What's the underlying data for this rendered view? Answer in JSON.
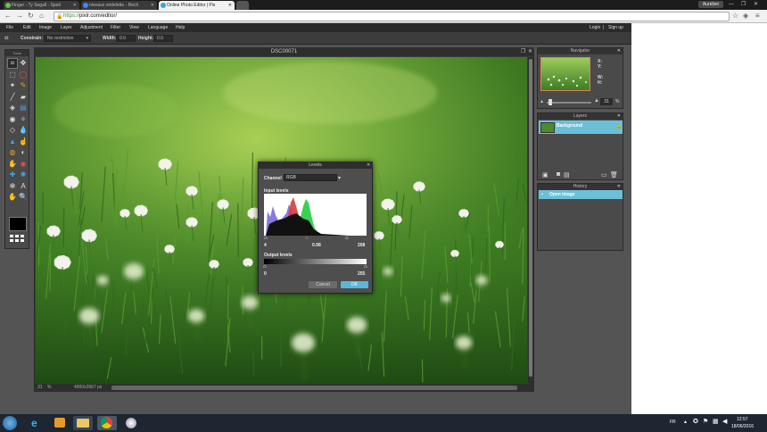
{
  "browser": {
    "tabs": [
      {
        "label": "Finger - Ty Segall - Spoti",
        "active": false,
        "favicon_color": "#6ac24b"
      },
      {
        "label": "niveaux ondelette - Rech",
        "active": false,
        "favicon_color": "#4285f4"
      },
      {
        "label": "Online Photo Editor | Pix",
        "active": true,
        "favicon_color": "#3aa6d0"
      }
    ],
    "profile_label": "Aurelien",
    "url_scheme": "https://",
    "url_rest": "pixlr.com/editor/"
  },
  "menubar": [
    "File",
    "Edit",
    "Image",
    "Layer",
    "Adjustment",
    "Filter",
    "View",
    "Language",
    "Help"
  ],
  "account": {
    "login": "Login",
    "separator": "|",
    "signup": "Sign up"
  },
  "options": {
    "constrain_label": "Constrain:",
    "constrain_value": "No restriction",
    "width_label": "Width:",
    "width_value": "0.0",
    "height_label": "Height:",
    "height_value": "0.0"
  },
  "tools": {
    "title": "Tools",
    "icons": [
      "crop-icon",
      "move-icon",
      "marquee-icon",
      "lasso-icon",
      "wand-icon",
      "pencil-icon",
      "brush-icon",
      "eraser-icon",
      "bucket-icon",
      "gradient-icon",
      "clone-icon",
      "color-replace-icon",
      "drawing-icon",
      "blur-icon",
      "sharpen-icon",
      "smudge-icon",
      "sponge-icon",
      "dodge-icon",
      "burn-icon",
      "red-eye-icon",
      "spot-heal-icon",
      "bloat-icon",
      "pinch-icon",
      "type-icon",
      "hand-icon",
      "zoom-icon"
    ]
  },
  "canvas": {
    "title": "DSC00071",
    "zoom": "31",
    "percent": "%",
    "dimensions": "4000x2667 px"
  },
  "navigator": {
    "title": "Navigator",
    "x_label": "X:",
    "y_label": "Y:",
    "w_label": "W:",
    "h_label": "H:",
    "zoom": "31",
    "percent": "%"
  },
  "layers": {
    "title": "Layers",
    "items": [
      {
        "name": "Background"
      }
    ]
  },
  "history": {
    "title": "History",
    "items": [
      {
        "name": "Open image"
      }
    ]
  },
  "dialog": {
    "title": "Levels",
    "channel_label": "Channel",
    "channel_value": "RGB",
    "input_label": "Input levels",
    "input_low": "4",
    "input_gamma": "0.98",
    "input_high": "208",
    "output_label": "Output levels",
    "output_low": "0",
    "output_high": "255",
    "cancel_label": "Cancel",
    "ok_label": "OK"
  },
  "taskbar": {
    "lang": "FR",
    "time": "12:57",
    "date": "18/06/2016"
  },
  "colors": {
    "accent": "#6bc0d8",
    "ok_button": "#5ab7d6",
    "cancel_button": "#6a6a6a"
  }
}
